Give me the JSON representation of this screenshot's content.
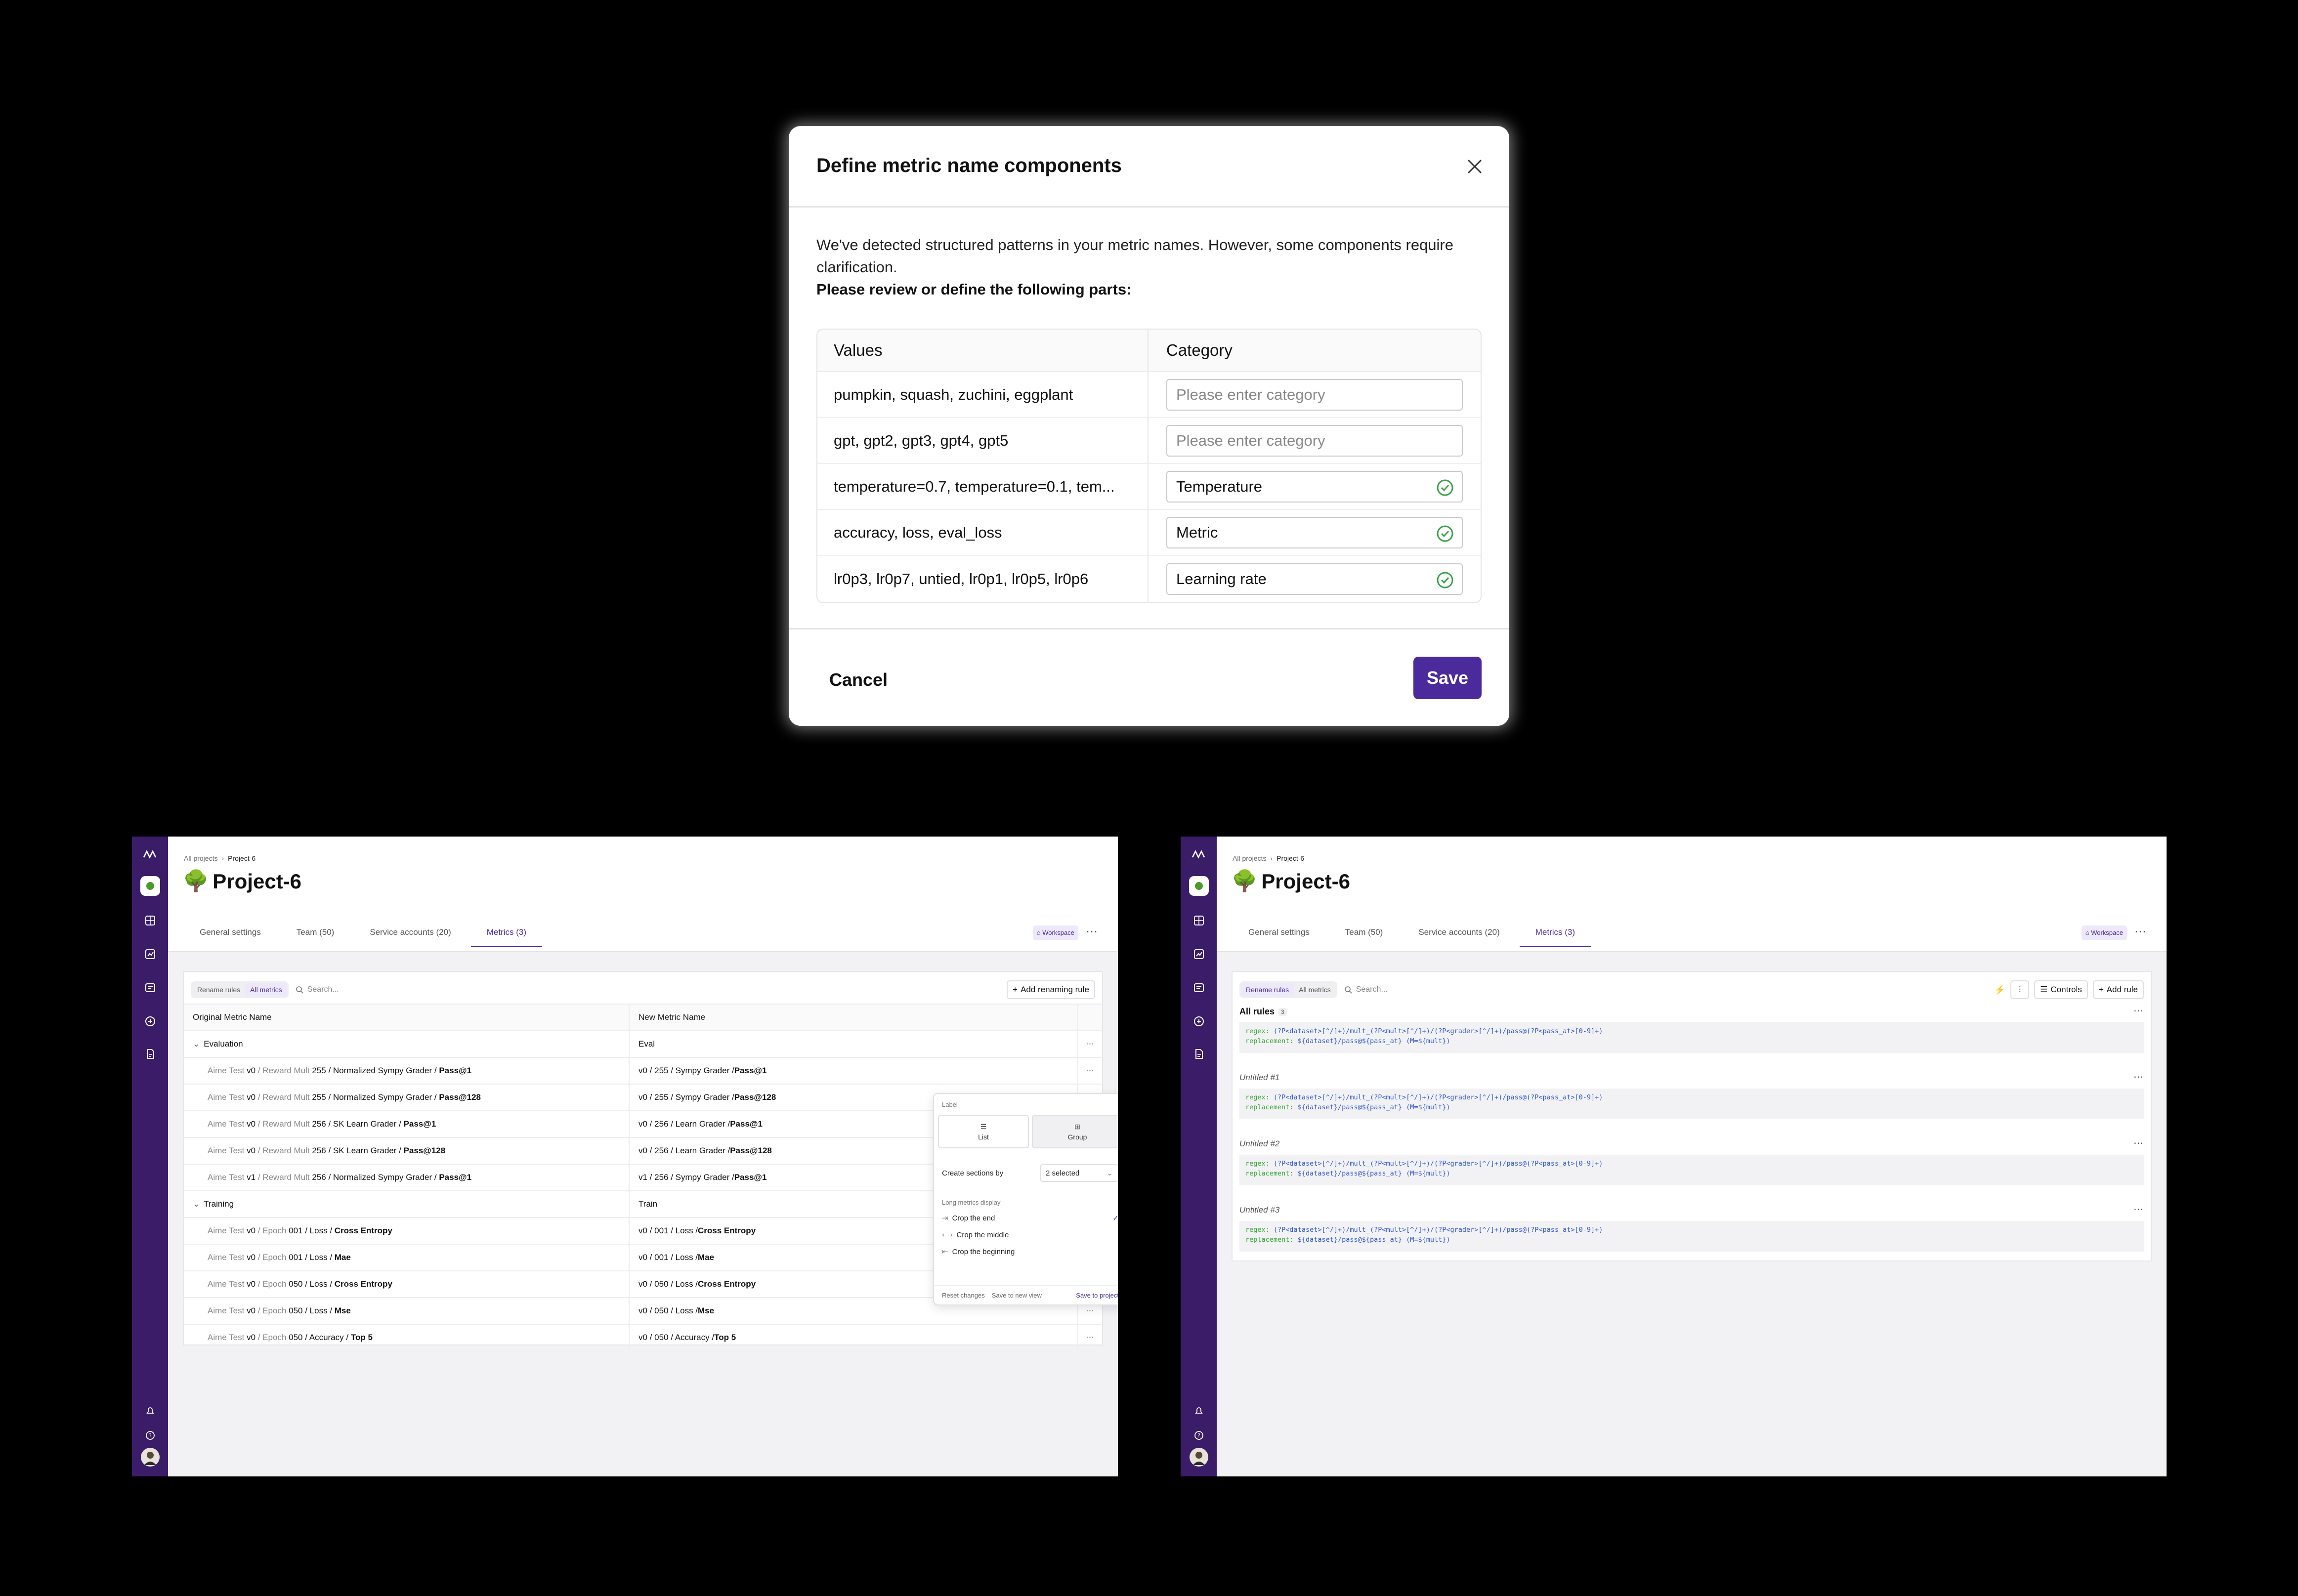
{
  "modal": {
    "title": "Define metric name components",
    "desc_line": "We've detected structured patterns in your metric names. However, some components require clarification.",
    "desc_bold": "Please review or define the following parts:",
    "col_values": "Values",
    "col_category": "Category",
    "rows": [
      {
        "values": "pumpkin, squash, zuchini, eggplant",
        "category": "",
        "placeholder": "Please enter category"
      },
      {
        "values": "gpt, gpt2, gpt3, gpt4, gpt5",
        "category": "",
        "placeholder": "Please enter category"
      },
      {
        "values": "temperature=0.7, temperature=0.1, tem...",
        "category": "Temperature",
        "placeholder": "Please enter category"
      },
      {
        "values": "accuracy, loss, eval_loss",
        "category": "Metric",
        "placeholder": "Please enter category"
      },
      {
        "values": "lr0p3, lr0p7, untied, lr0p1, lr0p5, lr0p6",
        "category": "Learning rate",
        "placeholder": "Please enter category"
      }
    ],
    "cancel": "Cancel",
    "save": "Save"
  },
  "app": {
    "crumb_root": "All projects",
    "crumb_current": "Project-6",
    "title": "Project-6",
    "title_emoji": "🌳",
    "tabs": [
      "General settings",
      "Team (50)",
      "Service accounts (20)",
      "Metrics (3)"
    ],
    "workspace": "Workspace",
    "search_placeholder": "Search...",
    "seg_rename": "Rename rules",
    "seg_all": "All metrics",
    "colors": {
      "accent": "#4b2a9b",
      "sidebar": "#3b1c69",
      "code_key": "#35a836",
      "code_value": "#3158d4"
    }
  },
  "left": {
    "add_rule": "Add renaming rule",
    "col_original": "Original Metric Name",
    "col_new": "New Metric Name",
    "groups": [
      {
        "name": "Evaluation",
        "new": "Eval",
        "rows": [
          {
            "o1": "Aime Test ",
            "o2": "v0",
            "o3": " / Reward Mult ",
            "o4": "255",
            "o5": " / Normalized Sympy Grader / ",
            "o6": "Pass@1",
            "n1": "v0 / 255 / Sympy Grader / ",
            "n2": "Pass@1"
          },
          {
            "o1": "Aime Test ",
            "o2": "v0",
            "o3": " / Reward Mult ",
            "o4": "255",
            "o5": " / Normalized Sympy Grader / ",
            "o6": "Pass@128",
            "n1": "v0 / 255 / Sympy Grader / ",
            "n2": "Pass@128"
          },
          {
            "o1": "Aime Test ",
            "o2": "v0",
            "o3": " / Reward Mult ",
            "o4": "256",
            "o5": " / SK Learn Grader / ",
            "o6": "Pass@1",
            "n1": "v0 / 256 / Learn Grader / ",
            "n2": "Pass@1"
          },
          {
            "o1": "Aime Test ",
            "o2": "v0",
            "o3": " / Reward Mult ",
            "o4": "256",
            "o5": " / SK Learn Grader / ",
            "o6": "Pass@128",
            "n1": "v0 / 256 / Learn Grader / ",
            "n2": "Pass@128"
          },
          {
            "o1": "Aime Test ",
            "o2": "v1",
            "o3": " / Reward Mult ",
            "o4": "256",
            "o5": " / Normalized Sympy Grader / ",
            "o6": "Pass@1",
            "n1": "v1 / 256 / Sympy Grader / ",
            "n2": "Pass@1"
          }
        ]
      },
      {
        "name": "Training",
        "new": "Train",
        "rows": [
          {
            "o1": "Aime Test ",
            "o2": "v0",
            "o3": " / Epoch ",
            "o4": "001",
            "o5": " / Loss / ",
            "o6": "Cross Entropy",
            "n1": "v0 / 001 / Loss / ",
            "n2": "Cross Entropy"
          },
          {
            "o1": "Aime Test ",
            "o2": "v0",
            "o3": " / Epoch ",
            "o4": "001",
            "o5": " / Loss / ",
            "o6": "Mae",
            "n1": "v0 / 001 / Loss / ",
            "n2": "Mae"
          },
          {
            "o1": "Aime Test ",
            "o2": "v0",
            "o3": " / Epoch ",
            "o4": "050",
            "o5": " / Loss / ",
            "o6": "Cross Entropy",
            "n1": "v0 / 050 / Loss / ",
            "n2": "Cross Entropy"
          },
          {
            "o1": "Aime Test ",
            "o2": "v0",
            "o3": " / Epoch ",
            "o4": "050",
            "o5": " / Loss / ",
            "o6": "Mse",
            "n1": "v0 / 050 / Loss / ",
            "n2": "Mse"
          },
          {
            "o1": "Aime Test ",
            "o2": "v0",
            "o3": " / Epoch ",
            "o4": "050",
            "o5": " / Accuracy / ",
            "o6": "Top 5",
            "n1": "v0 / 050 / Accuracy / ",
            "n2": "Top 5"
          }
        ]
      }
    ],
    "popover": {
      "label": "Label",
      "opt_list": "List",
      "opt_group": "Group",
      "sections_label": "Create sections by",
      "sections_value": "2 selected",
      "long_label": "Long metrics display",
      "crop_end": "Crop the end",
      "crop_middle": "Crop the middle",
      "crop_beginning": "Crop the beginning",
      "reset": "Reset changes",
      "save_view": "Save to new view",
      "save_project": "Save to project"
    }
  },
  "right": {
    "controls": "Controls",
    "add_rule": "Add rule",
    "all_rules": "All rules",
    "all_rules_count": "3",
    "rules": [
      {
        "title": "",
        "regex": "(?P<dataset>[^/]+)/mult_(?P<mult>[^/]+)/(?P<grader>[^/]+)/pass@(?P<pass_at>[0-9]+)",
        "replacement": "${dataset}/pass@${pass_at} (M=${mult})"
      },
      {
        "title": "Untitled #1",
        "regex": "(?P<dataset>[^/]+)/mult_(?P<mult>[^/]+)/(?P<grader>[^/]+)/pass@(?P<pass_at>[0-9]+)",
        "replacement": "${dataset}/pass@${pass_at} (M=${mult})"
      },
      {
        "title": "Untitled #2",
        "regex": "(?P<dataset>[^/]+)/mult_(?P<mult>[^/]+)/(?P<grader>[^/]+)/pass@(?P<pass_at>[0-9]+)",
        "replacement": "${dataset}/pass@${pass_at} (M=${mult})"
      },
      {
        "title": "Untitled #3",
        "regex": "(?P<dataset>[^/]+)/mult_(?P<mult>[^/]+)/(?P<grader>[^/]+)/pass@(?P<pass_at>[0-9]+)",
        "replacement": "${dataset}/pass@${pass_at} (M=${mult})"
      }
    ],
    "regex_key": "regex:",
    "replacement_key": "replacement:"
  }
}
